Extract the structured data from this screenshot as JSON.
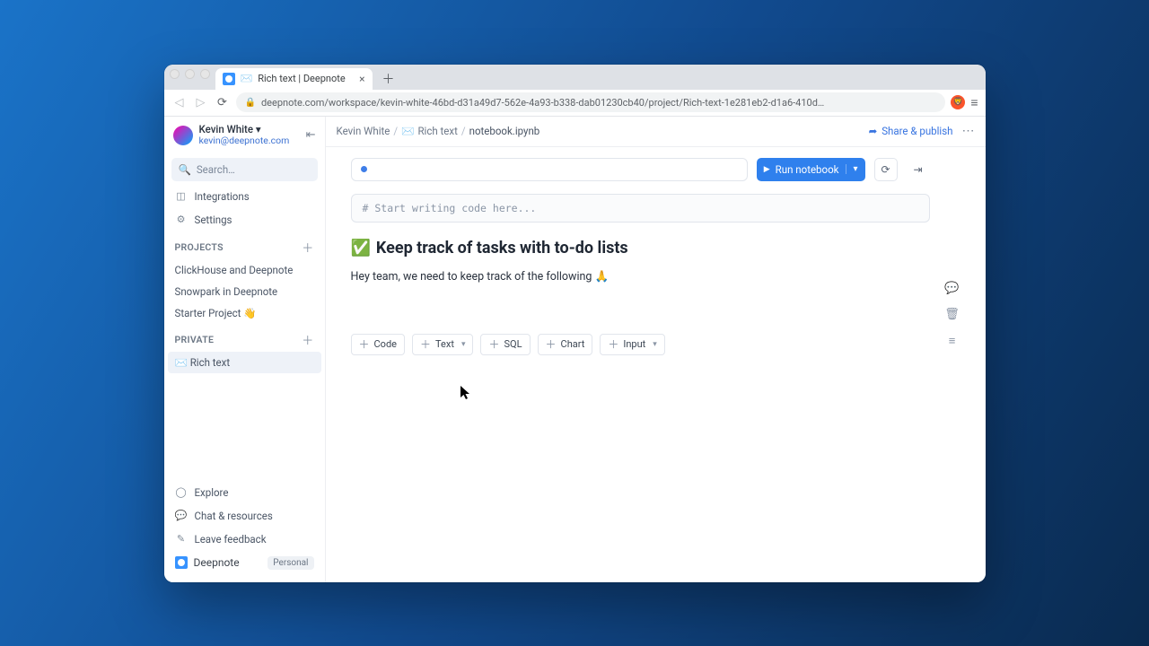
{
  "browser": {
    "tab_title": "Rich text | Deepnote",
    "url": "deepnote.com/workspace/kevin-white-46bd-d31a49d7-562e-4a93-b338-dab01230cb40/project/Rich-text-1e281eb2-d1a6-410d…"
  },
  "user": {
    "name": "Kevin White",
    "email": "kevin@deepnote.com"
  },
  "search": {
    "placeholder": "Search…"
  },
  "sidebar": {
    "integrations": "Integrations",
    "settings": "Settings",
    "section_projects": "PROJECTS",
    "section_private": "PRIVATE",
    "projects": [
      {
        "label": "ClickHouse and Deepnote"
      },
      {
        "label": "Snowpark in Deepnote"
      },
      {
        "label": "Starter Project 👋"
      }
    ],
    "private": [
      {
        "emoji": "✉️",
        "label": "Rich text"
      }
    ],
    "explore": "Explore",
    "chat": "Chat & resources",
    "feedback": "Leave feedback",
    "brand": "Deepnote",
    "badge": "Personal"
  },
  "crumbs": {
    "a": "Kevin White",
    "b_emoji": "✉️",
    "b": "Rich text",
    "c": "notebook.ipynb",
    "share": "Share & publish"
  },
  "toolbar": {
    "run": "Run notebook"
  },
  "notebook": {
    "code_placeholder": "# Start writing code here...",
    "heading_emoji": "✅",
    "heading": "Keep track of tasks with to-do lists",
    "paragraph": "Hey team, we need to keep track of the following 🙏"
  },
  "add": {
    "code": "Code",
    "text": "Text",
    "sql": "SQL",
    "chart": "Chart",
    "input": "Input"
  }
}
